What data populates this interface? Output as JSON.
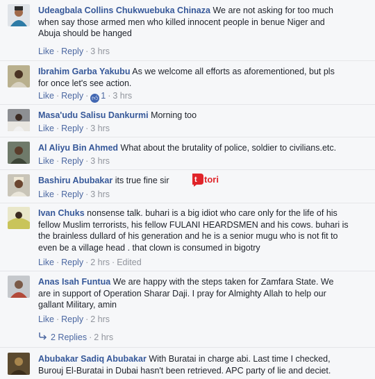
{
  "comments": [
    {
      "author": "Udeagbala Collins Chukwuebuka Chinaza",
      "text": "We are not asking for too much when say those armed men who killed innocent people in benue Niger and Abuja should be hanged",
      "like": "Like",
      "reply": "Reply",
      "time": "3 hrs"
    },
    {
      "author": "Ibrahim Garba Yakubu",
      "text": "As we welcome all efforts as aforementioned, but pls for once let's see action.",
      "like": "Like",
      "reply": "Reply",
      "likes_count": "1",
      "time": "3 hrs"
    },
    {
      "author": "Masa'udu Salisu Dankurmi",
      "text": "Morning too",
      "like": "Like",
      "reply": "Reply",
      "time": "3 hrs"
    },
    {
      "author": "Al Aliyu Bin Ahmed",
      "text": "What about the brutality of police, soldier to civilians.etc.",
      "like": "Like",
      "reply": "Reply",
      "time": "3 hrs"
    },
    {
      "author": "Bashiru Abubakar",
      "text": "its true fine sir",
      "like": "Like",
      "reply": "Reply",
      "time": "3 hrs"
    },
    {
      "author": "Ivan Chuks",
      "text": "nonsense talk. buhari is a big idiot who care only for the life of his fellow Muslim terrorists, his fellow FULANI HEARDSMEN and his cows. buhari is the brainless dullard of his generation and he is a senior mugu who is not fit to even be a village head . that clown is consumed in bigotry",
      "like": "Like",
      "reply": "Reply",
      "time": "2 hrs",
      "edited": "Edited"
    },
    {
      "author": "Anas Isah Funtua",
      "text": "We are happy with the steps taken for Zamfara State. We are in support of Operation Sharar Daji. I pray for Almighty Allah to help our gallant Military, amin",
      "like": "Like",
      "reply": "Reply",
      "time": "2 hrs"
    },
    {
      "author": "Abubakar Sadiq Abubakar",
      "text": "With Buratai in charge abi. Last time I checked, Burouj El-Buratai in Dubai hasn't been retrieved. APC party of lie and deciet."
    }
  ],
  "replies": {
    "label": "2 Replies",
    "time": "2 hrs",
    "icon": "reply-arrow-icon"
  },
  "watermark": {
    "text": "tori",
    "icon": "tori-logo-icon"
  },
  "colors": {
    "link": "#365899",
    "meta": "#90949c",
    "background": "#f6f7f9",
    "brand": "#e0242a"
  }
}
